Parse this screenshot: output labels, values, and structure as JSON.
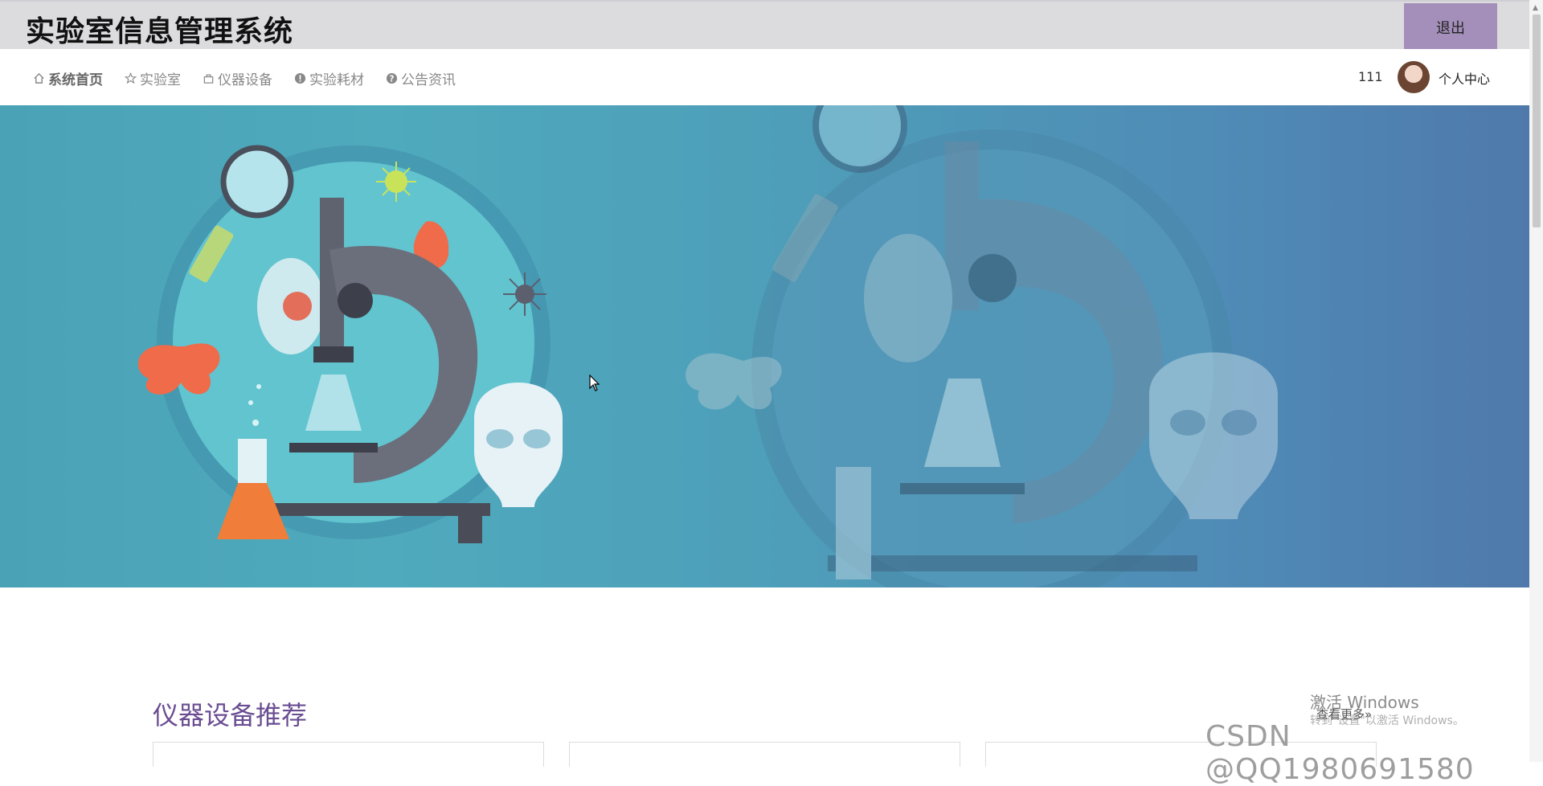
{
  "header": {
    "app_title": "实验室信息管理系统",
    "logout_label": "退出",
    "accent_color": "#a48fbb"
  },
  "nav": {
    "items": [
      {
        "label": "系统首页",
        "icon": "home-icon",
        "active": true
      },
      {
        "label": "实验室",
        "icon": "star-icon"
      },
      {
        "label": "仪器设备",
        "icon": "bag-icon"
      },
      {
        "label": "实验耗材",
        "icon": "info-icon"
      },
      {
        "label": "公告资讯",
        "icon": "question-icon"
      }
    ],
    "count": "111",
    "user_center_label": "个人中心"
  },
  "banner": {
    "illustration": "laboratory-microscope"
  },
  "main": {
    "section_title": "仪器设备推荐",
    "title_color": "#6a4d92"
  },
  "overlay": {
    "activate_windows": "激活 Windows",
    "view_more": "查看更多»",
    "activate_hint": "转到\"设置\"以激活 Windows。",
    "csdn_watermark": "CSDN @QQ1980691580"
  }
}
